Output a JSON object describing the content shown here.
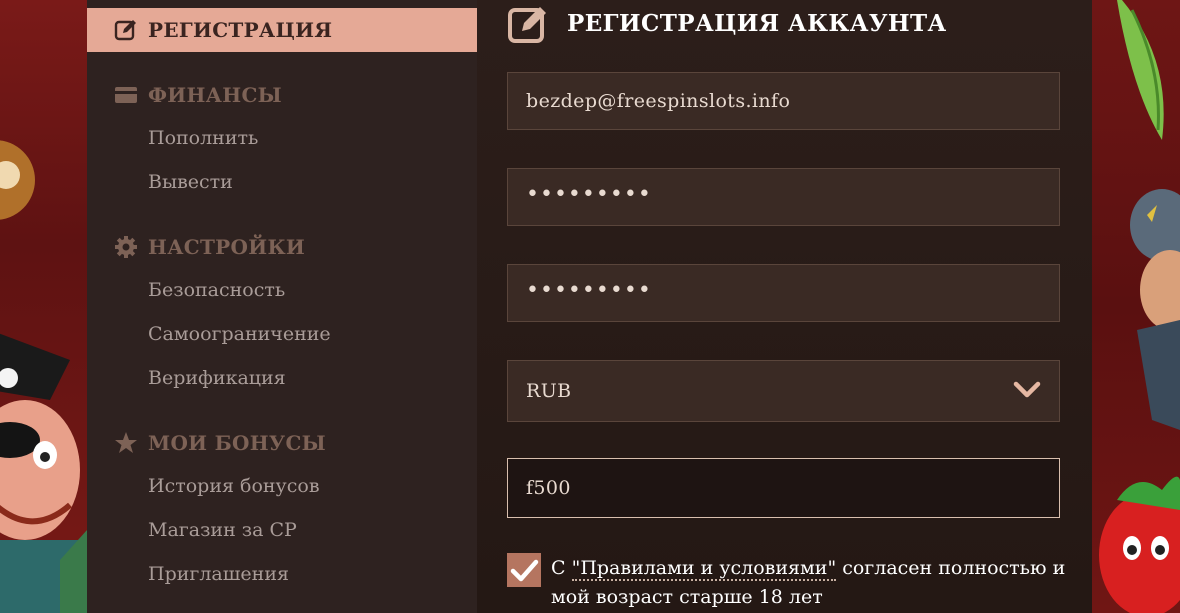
{
  "sidebar": {
    "active": {
      "label": "РЕГИСТРАЦИЯ",
      "icon": "edit-icon"
    },
    "finance": {
      "label": "ФИНАНСЫ",
      "icon": "card-icon",
      "items": [
        "Пополнить",
        "Вывести"
      ]
    },
    "settings": {
      "label": "НАСТРОЙКИ",
      "icon": "gear-icon",
      "items": [
        "Безопасность",
        "Самоограничение",
        "Верификация"
      ]
    },
    "bonuses": {
      "label": "МОИ БОНУСЫ",
      "icon": "star-icon",
      "items": [
        "История бонусов",
        "Магазин за CP",
        "Приглашения"
      ]
    }
  },
  "main": {
    "title": "РЕГИСТРАЦИЯ АККАУНТА",
    "title_icon": "edit-icon",
    "email": "bezdep@freespinslots.info",
    "password": "•••••••••",
    "password_confirm": "•••••••••",
    "currency": "RUB",
    "promo_code": "f500",
    "consent": {
      "prefix": "С ",
      "link": "\"Правилами и условиями\"",
      "suffix": " согласен полностью и мой возраст старше 18 лет"
    }
  },
  "colors": {
    "accent": "#e5a996",
    "sidebar_bg": "#2e2220",
    "field_bg": "#3a2a24",
    "checkbox": "#b57560"
  }
}
